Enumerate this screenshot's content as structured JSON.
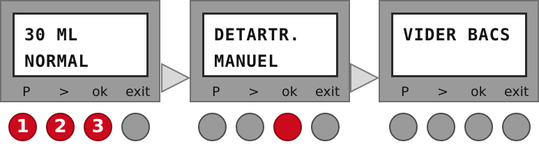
{
  "panels": [
    {
      "line1": "30 ML",
      "line2": "NORMAL",
      "softkeys": [
        "P",
        ">",
        "ok",
        "exit"
      ],
      "buttons": [
        {
          "state": "pressed",
          "number": "1"
        },
        {
          "state": "pressed",
          "number": "2"
        },
        {
          "state": "pressed",
          "number": "3"
        },
        {
          "state": "idle",
          "number": ""
        }
      ]
    },
    {
      "line1": "DETARTR.",
      "line2": "MANUEL",
      "softkeys": [
        "P",
        ">",
        "ok",
        "exit"
      ],
      "buttons": [
        {
          "state": "idle",
          "number": ""
        },
        {
          "state": "idle",
          "number": ""
        },
        {
          "state": "pressed",
          "number": ""
        },
        {
          "state": "idle",
          "number": ""
        }
      ]
    },
    {
      "line1": "VIDER BACS",
      "line2": "",
      "softkeys": [
        "P",
        ">",
        "ok",
        "exit"
      ],
      "buttons": [
        {
          "state": "idle",
          "number": ""
        },
        {
          "state": "idle",
          "number": ""
        },
        {
          "state": "idle",
          "number": ""
        },
        {
          "state": "idle",
          "number": ""
        }
      ]
    }
  ],
  "colors": {
    "panel": "#9a9a9a",
    "screen": "#ffffff",
    "button_idle": "#9a9a9a",
    "button_pressed": "#cc0a1e"
  }
}
